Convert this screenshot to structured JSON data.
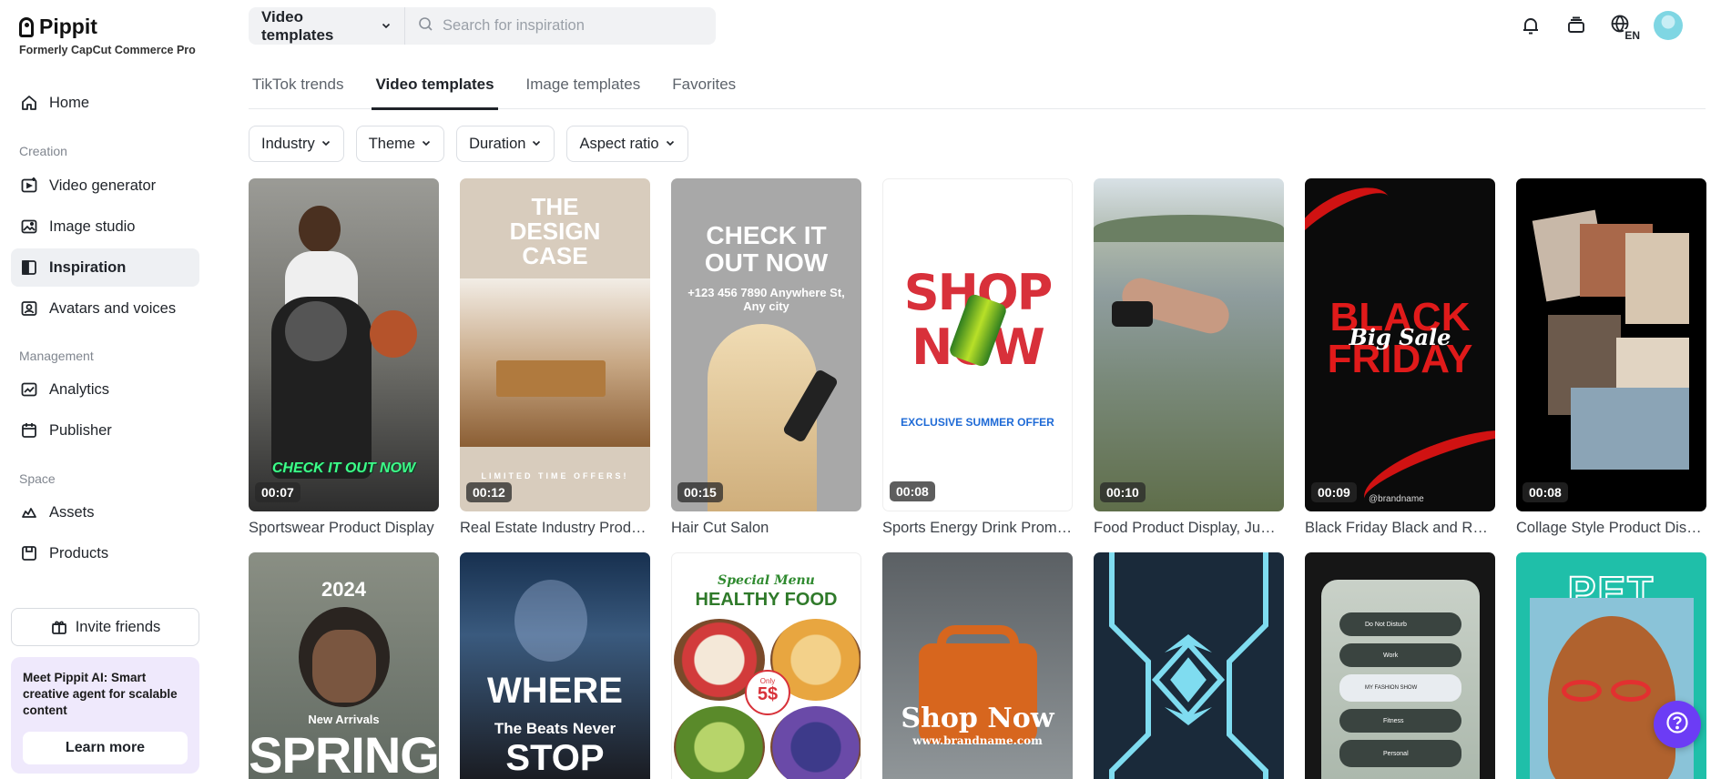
{
  "brand": {
    "name": "Pippit",
    "subtitle": "Formerly CapCut Commerce Pro"
  },
  "sidebar": {
    "home": "Home",
    "sections": {
      "creation": "Creation",
      "management": "Management",
      "space": "Space"
    },
    "creation_items": [
      "Video generator",
      "Image studio",
      "Inspiration",
      "Avatars and voices"
    ],
    "management_items": [
      "Analytics",
      "Publisher"
    ],
    "space_items": [
      "Assets",
      "Products"
    ],
    "active": "Inspiration",
    "invite": "Invite friends",
    "promo": {
      "text": "Meet Pippit AI: Smart creative agent for scalable content",
      "button": "Learn more"
    }
  },
  "topbar": {
    "template_select": "Video templates",
    "search_placeholder": "Search for inspiration",
    "icons": [
      "bell-icon",
      "stack-icon",
      "globe-language-icon"
    ],
    "language": "EN"
  },
  "tabs": [
    "TikTok trends",
    "Video templates",
    "Image templates",
    "Favorites"
  ],
  "active_tab": "Video templates",
  "filters": [
    "Industry",
    "Theme",
    "Duration",
    "Aspect ratio"
  ],
  "cards_row1": [
    {
      "title": "Sportswear Product Display",
      "duration": "00:07",
      "overlay": "CHECK IT OUT NOW"
    },
    {
      "title": "Real Estate Industry Produ...",
      "duration": "00:12",
      "overlay": "THE DESIGN CASE",
      "overlay_sub": "LIMITED TIME OFFERS!"
    },
    {
      "title": "Hair Cut Salon",
      "duration": "00:15",
      "overlay": "CHECK IT OUT NOW",
      "overlay_sub": "+123 456 7890 Anywhere St, Any city"
    },
    {
      "title": "Sports Energy Drink Promo...",
      "duration": "00:08",
      "overlay": "SHOP NOW",
      "overlay_sub": "EXCLUSIVE SUMMER OFFER"
    },
    {
      "title": "Food Product Display, Jum...",
      "duration": "00:10"
    },
    {
      "title": "Black Friday Black and Red...",
      "duration": "00:09",
      "overlay": "BLACK FRIDAY",
      "overlay_script": "Big Sale",
      "overlay_sub": "@brandname"
    },
    {
      "title": "Collage Style Product Displ...",
      "duration": "00:08"
    }
  ],
  "cards_row2": [
    {
      "overlay": "2024",
      "overlay_sub": "New Arrivals",
      "overlay_big": "SPRING"
    },
    {
      "overlay": "WHERE",
      "overlay_sub": "The Beats Never",
      "overlay_big": "STOP"
    },
    {
      "overlay_script": "Special Menu",
      "overlay": "HEALTHY FOOD",
      "badge_top": "Only",
      "badge_price": "5$"
    },
    {
      "overlay": "Shop Now",
      "overlay_sub": "www.brandname.com"
    },
    {},
    {
      "rows": [
        "Do Not Disturb",
        "Work",
        "MY FASHION SHOW",
        "Fitness",
        "Personal"
      ]
    },
    {
      "overlay": "PET FOOD"
    }
  ]
}
